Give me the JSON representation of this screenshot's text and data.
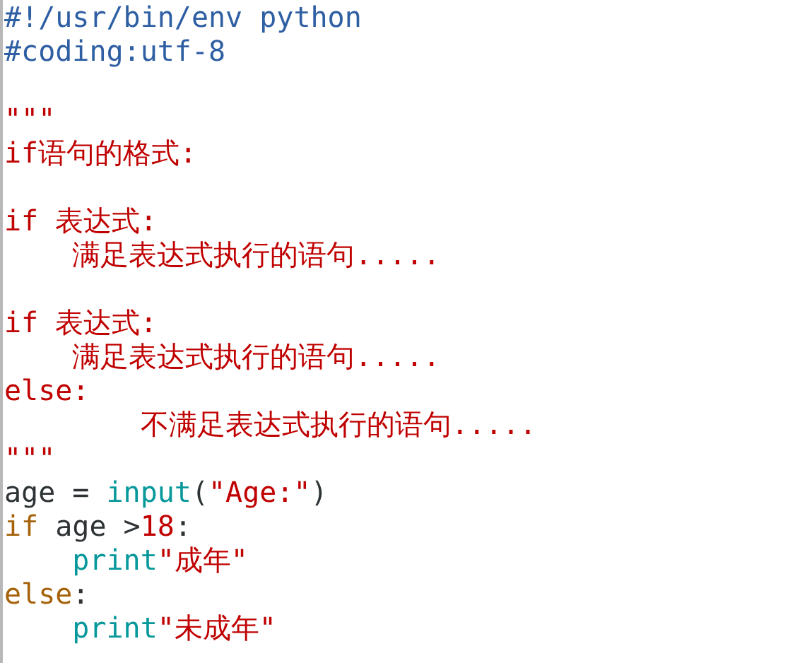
{
  "editor": {
    "lines": [
      {
        "tokens": [
          {
            "kind": "comment",
            "text": "#!/usr/bin/env python"
          }
        ]
      },
      {
        "tokens": [
          {
            "kind": "comment",
            "text": "#coding:utf-8"
          }
        ]
      },
      {
        "kind": "blank"
      },
      {
        "tokens": [
          {
            "kind": "string",
            "text": "\"\"\""
          }
        ]
      },
      {
        "tokens": [
          {
            "kind": "string",
            "text": "if语句的格式:"
          }
        ]
      },
      {
        "kind": "blank"
      },
      {
        "tokens": [
          {
            "kind": "string",
            "text": "if 表达式:"
          }
        ]
      },
      {
        "tokens": [
          {
            "kind": "string",
            "text": "    满足表达式执行的语句....."
          }
        ]
      },
      {
        "kind": "blank"
      },
      {
        "tokens": [
          {
            "kind": "string",
            "text": "if 表达式:"
          }
        ]
      },
      {
        "tokens": [
          {
            "kind": "string",
            "text": "    满足表达式执行的语句....."
          }
        ]
      },
      {
        "tokens": [
          {
            "kind": "string",
            "text": "else:"
          }
        ]
      },
      {
        "tokens": [
          {
            "kind": "string",
            "text": "        不满足表达式执行的语句....."
          }
        ]
      },
      {
        "tokens": [
          {
            "kind": "string",
            "text": "\"\"\""
          }
        ]
      },
      {
        "tokens": [
          {
            "kind": "plain",
            "text": "age = "
          },
          {
            "kind": "builtin",
            "text": "input"
          },
          {
            "kind": "plain",
            "text": "("
          },
          {
            "kind": "string",
            "text": "\"Age:\""
          },
          {
            "kind": "plain",
            "text": ")"
          }
        ]
      },
      {
        "tokens": [
          {
            "kind": "keyword",
            "text": "if"
          },
          {
            "kind": "plain",
            "text": " age >"
          },
          {
            "kind": "number",
            "text": "18"
          },
          {
            "kind": "plain",
            "text": ":"
          }
        ]
      },
      {
        "tokens": [
          {
            "kind": "builtin",
            "text": "    print"
          },
          {
            "kind": "string",
            "text": "\"成年\""
          }
        ]
      },
      {
        "tokens": [
          {
            "kind": "keyword",
            "text": "else"
          },
          {
            "kind": "plain",
            "text": ":"
          }
        ]
      },
      {
        "tokens": [
          {
            "kind": "builtin",
            "text": "    print"
          },
          {
            "kind": "string",
            "text": "\"未成年\""
          }
        ]
      }
    ]
  }
}
